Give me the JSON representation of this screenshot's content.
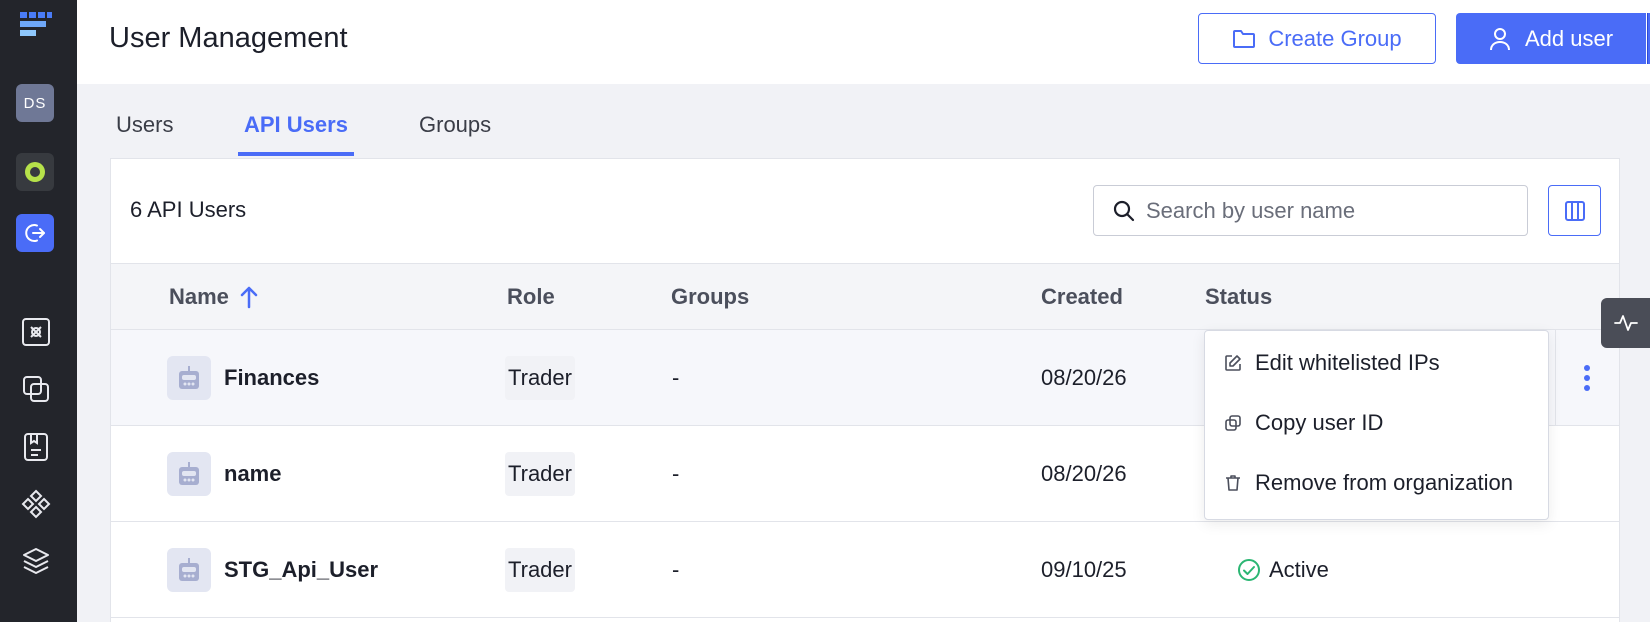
{
  "sidebar": {
    "avatar_initials": "DS",
    "nav_icons": [
      "scan-icon",
      "copy-icon",
      "receipt-icon",
      "diamond-grid-icon",
      "layers-icon"
    ]
  },
  "header": {
    "title": "User Management",
    "create_group_label": "Create Group",
    "add_user_label": "Add user"
  },
  "tabs": [
    {
      "label": "Users",
      "active": false
    },
    {
      "label": "API Users",
      "active": true
    },
    {
      "label": "Groups",
      "active": false
    }
  ],
  "toolbar": {
    "count_label": "6 API Users",
    "search_placeholder": "Search by user name"
  },
  "table": {
    "headers": {
      "name": "Name",
      "role": "Role",
      "groups": "Groups",
      "created": "Created",
      "status": "Status"
    },
    "sort": {
      "column": "Name",
      "direction": "ascending"
    },
    "rows": [
      {
        "name": "Finances",
        "role": "Trader",
        "groups": "-",
        "created": "08/20/26",
        "status": ""
      },
      {
        "name": "name",
        "role": "Trader",
        "groups": "-",
        "created": "08/20/26",
        "status": ""
      },
      {
        "name": "STG_Api_User",
        "role": "Trader",
        "groups": "-",
        "created": "09/10/25",
        "status": "Active"
      }
    ]
  },
  "menu": {
    "items": [
      {
        "label": "Edit whitelisted IPs",
        "icon": "edit-icon"
      },
      {
        "label": "Copy user ID",
        "icon": "copy-icon"
      },
      {
        "label": "Remove from organization",
        "icon": "trash-icon"
      }
    ]
  },
  "colors": {
    "accent": "#4a6cf7",
    "sidebar": "#23252b",
    "status_active": "#2bb673"
  }
}
